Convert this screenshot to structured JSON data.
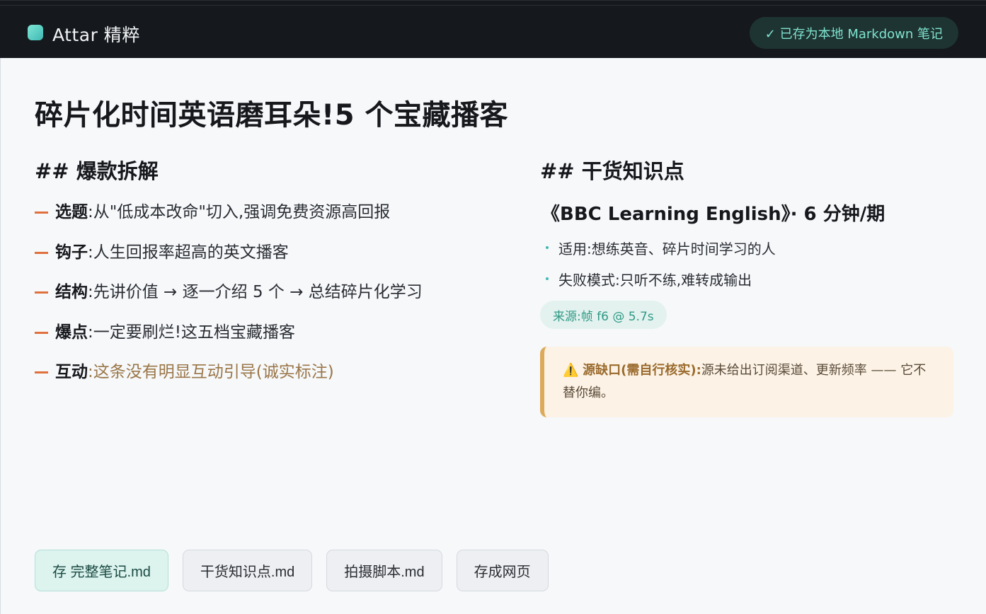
{
  "app": {
    "title": "Attar 精粹"
  },
  "header": {
    "saved_badge": "✓ 已存为本地 Markdown 笔记"
  },
  "page": {
    "title": "碎片化时间英语磨耳朵!5 个宝藏播客"
  },
  "breakdown": {
    "heading": "## 爆款拆解",
    "items": [
      {
        "key": "选题",
        "colon": ":",
        "value": "从\"低成本改命\"切入,强调免费资源高回报",
        "muted": false
      },
      {
        "key": "钩子",
        "colon": ":",
        "value": "人生回报率超高的英文播客",
        "muted": false
      },
      {
        "key": "结构",
        "colon": ":",
        "value": "先讲价值 → 逐一介绍 5 个 → 总结碎片化学习",
        "muted": false
      },
      {
        "key": "爆点",
        "colon": ":",
        "value": "一定要刷烂!这五档宝藏播客",
        "muted": false
      },
      {
        "key": "互动",
        "colon": ":",
        "value": "这条没有明显互动引导(诚实标注)",
        "muted": true
      }
    ]
  },
  "knowledge": {
    "heading": "## 干货知识点",
    "title": "《BBC Learning English》· 6 分钟/期",
    "items": [
      "适用:想练英音、碎片时间学习的人",
      "失败模式:只听不练,难转成输出"
    ],
    "source": "来源:帧 f6 @ 5.7s",
    "warning": {
      "icon": "⚠️",
      "title": "源缺口(需自行核实):",
      "text": "源未给出订阅渠道、更新频率 —— 它不替你编。"
    }
  },
  "actions": [
    {
      "label": "存 完整笔记.md",
      "primary": true
    },
    {
      "label": "干货知识点.md",
      "primary": false
    },
    {
      "label": "拍摄脚本.md",
      "primary": false
    },
    {
      "label": "存成网页",
      "primary": false
    }
  ]
}
